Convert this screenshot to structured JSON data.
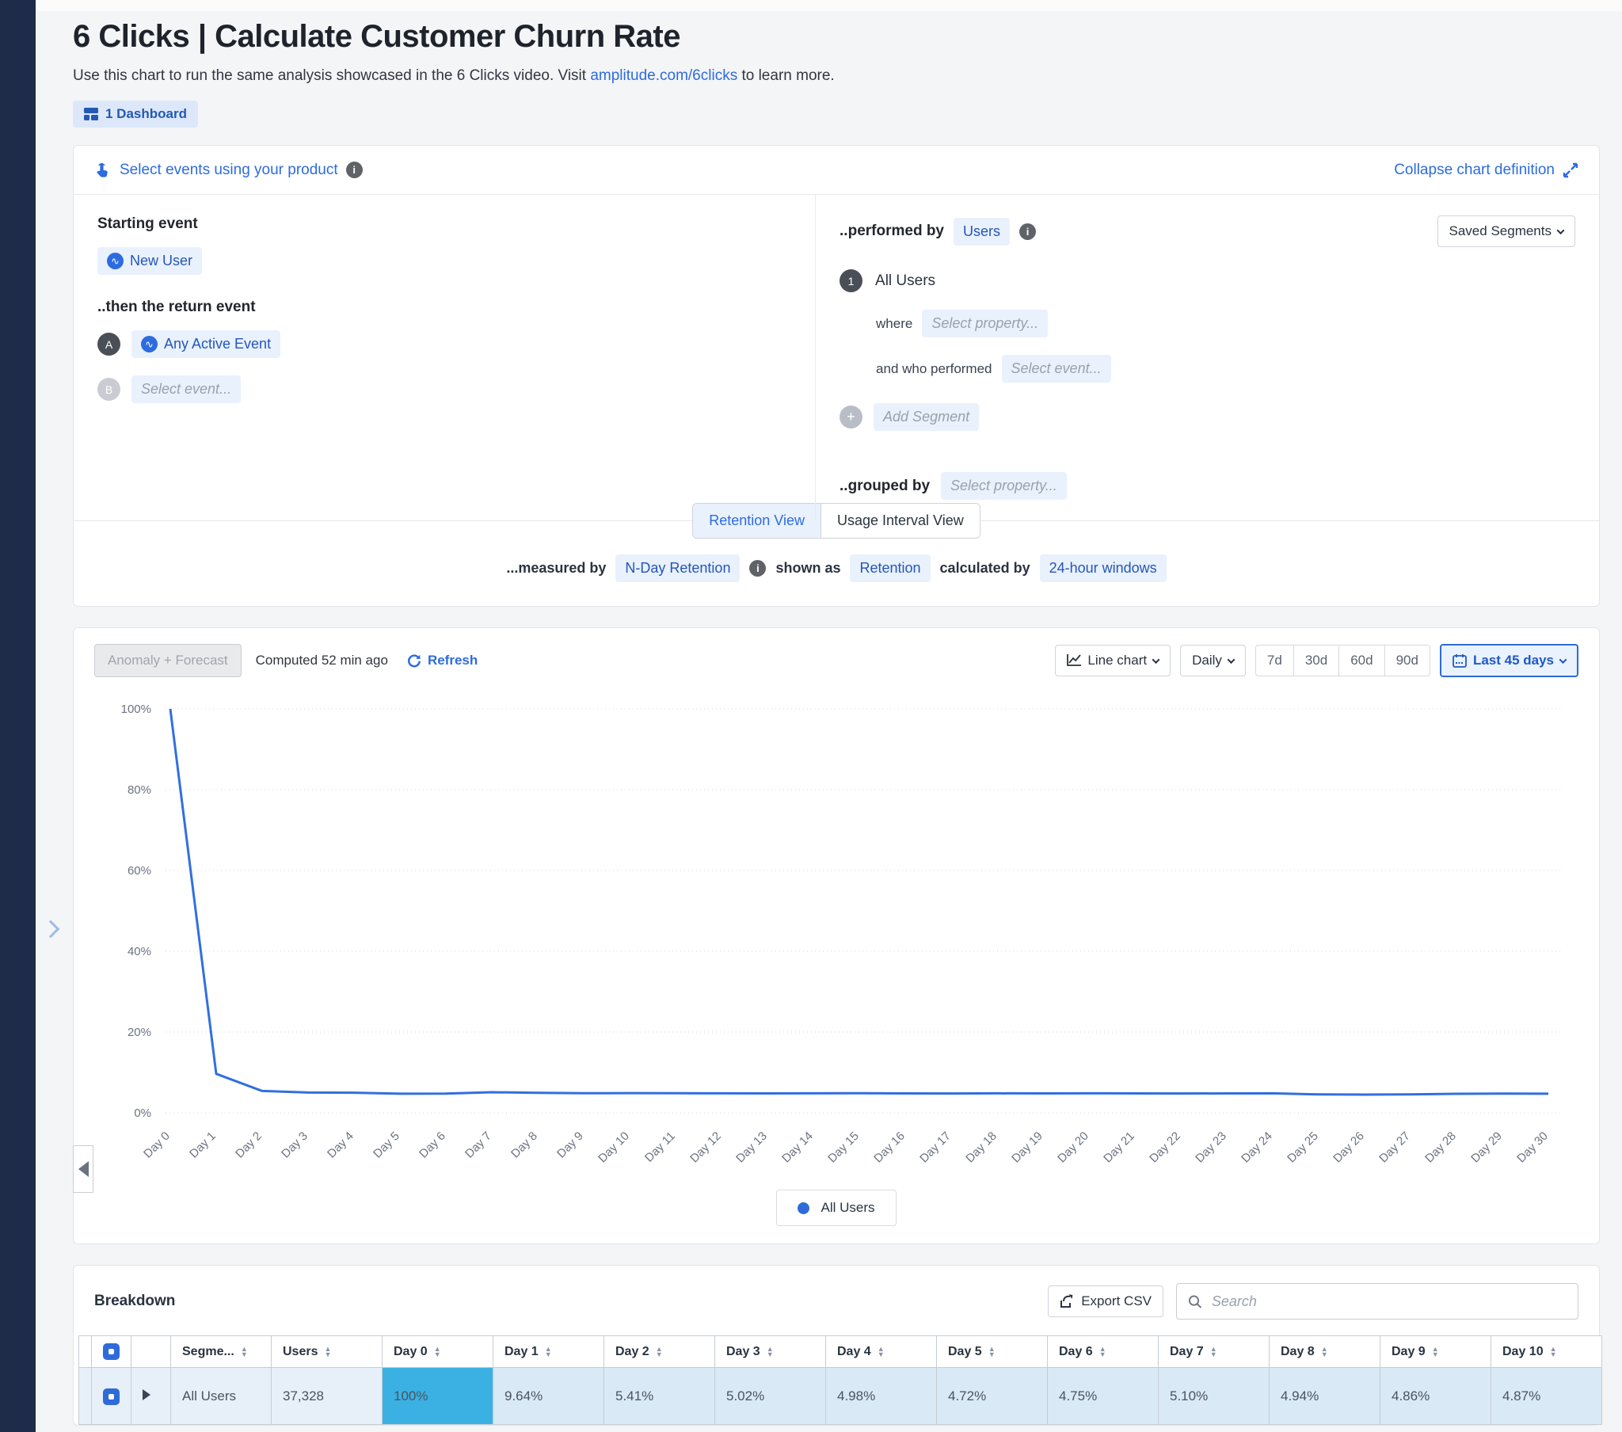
{
  "page": {
    "title": "6 Clicks | Calculate Customer Churn Rate",
    "subtitle_prefix": "Use this chart to run the same analysis showcased in the 6 Clicks video. Visit ",
    "subtitle_link": "amplitude.com/6clicks",
    "subtitle_suffix": " to learn more.",
    "dashboard_badge": "1 Dashboard"
  },
  "definition": {
    "header_link": "Select events using your product",
    "collapse_link": "Collapse chart definition",
    "starting_event_label": "Starting event",
    "starting_event": "New User",
    "return_event_label": "..then the return event",
    "event_a_letter": "A",
    "event_a": "Any Active Event",
    "event_b_letter": "B",
    "event_b_placeholder": "Select event...",
    "performed_by_label": "..performed by",
    "performed_by_value": "Users",
    "saved_segments_label": "Saved Segments",
    "segment_number": "1",
    "segment_name": "All Users",
    "where_label": "where",
    "where_placeholder": "Select property...",
    "who_performed_label": "and who performed",
    "who_performed_placeholder": "Select event...",
    "add_segment_label": "Add Segment",
    "grouped_by_label": "..grouped by",
    "grouped_by_placeholder": "Select property...",
    "tabs": [
      {
        "label": "Retention View",
        "active": true
      },
      {
        "label": "Usage Interval View",
        "active": false
      }
    ],
    "measured_by_label": "...measured by",
    "measured_by_value": "N-Day Retention",
    "shown_as_label": "shown as",
    "shown_as_value": "Retention",
    "calculated_by_label": "calculated by",
    "calculated_by_value": "24-hour windows"
  },
  "toolbar": {
    "anomaly_button": "Anomaly + Forecast",
    "computed_text": "Computed 52 min ago",
    "refresh_label": "Refresh",
    "chart_type_label": "Line chart",
    "interval_label": "Daily",
    "ranges": [
      "7d",
      "30d",
      "60d",
      "90d"
    ],
    "date_range_label": "Last 45 days"
  },
  "chart_data": {
    "type": "line",
    "title": "N-Day Retention of All Users",
    "x": [
      "Day 0",
      "Day 1",
      "Day 2",
      "Day 3",
      "Day 4",
      "Day 5",
      "Day 6",
      "Day 7",
      "Day 8",
      "Day 9",
      "Day 10",
      "Day 11",
      "Day 12",
      "Day 13",
      "Day 14",
      "Day 15",
      "Day 16",
      "Day 17",
      "Day 18",
      "Day 19",
      "Day 20",
      "Day 21",
      "Day 22",
      "Day 23",
      "Day 24",
      "Day 25",
      "Day 26",
      "Day 27",
      "Day 28",
      "Day 29",
      "Day 30"
    ],
    "series": [
      {
        "name": "All Users",
        "values": [
          100,
          9.64,
          5.41,
          5.02,
          4.98,
          4.72,
          4.75,
          5.1,
          4.94,
          4.86,
          4.87,
          4.85,
          4.83,
          4.8,
          4.82,
          4.85,
          4.8,
          4.78,
          4.82,
          4.8,
          4.83,
          4.8,
          4.78,
          4.8,
          4.82,
          4.55,
          4.5,
          4.55,
          4.7,
          4.75,
          4.72
        ]
      }
    ],
    "xlabel": "",
    "ylabel": "",
    "ylim": [
      0,
      100
    ],
    "yticks": [
      "100%",
      "80%",
      "60%",
      "40%",
      "20%",
      "0%"
    ],
    "grid": true,
    "legend_position": "bottom"
  },
  "legend": {
    "label": "All Users"
  },
  "breakdown": {
    "title": "Breakdown",
    "export_label": "Export CSV",
    "search_placeholder": "Search",
    "columns": [
      "Segme...",
      "Users",
      "Day 0",
      "Day 1",
      "Day 2",
      "Day 3",
      "Day 4",
      "Day 5",
      "Day 6",
      "Day 7",
      "Day 8",
      "Day 9",
      "Day 10"
    ],
    "row": {
      "segment": "All Users",
      "users": "37,328",
      "values": [
        "100%",
        "9.64%",
        "5.41%",
        "5.02%",
        "4.98%",
        "4.72%",
        "4.75%",
        "5.10%",
        "4.94%",
        "4.86%",
        "4.87%"
      ]
    }
  },
  "colors": {
    "accent_blue": "#2d6be0",
    "line_blue": "#316fe0",
    "chip_bg": "#e9f1fd",
    "day0_cell": "#3bb1e3",
    "day_cell": "#d9e9f5",
    "nav_rail": "#1e2b49"
  }
}
